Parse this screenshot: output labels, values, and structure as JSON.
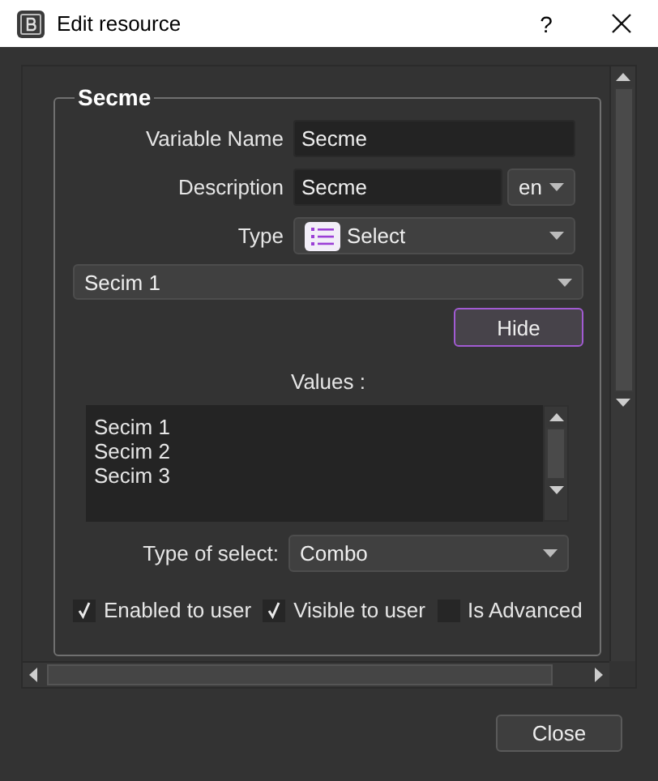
{
  "window": {
    "title": "Edit resource",
    "help": "?"
  },
  "group": {
    "title": "Secme"
  },
  "fields": [
    {
      "label": "Variable Name",
      "value": "Secme"
    },
    {
      "label": "Description",
      "value": "Secme",
      "language": "en"
    }
  ],
  "type": {
    "label": "Type",
    "value": "Select"
  },
  "selection": {
    "value": "Secim 1"
  },
  "hide_button": "Hide",
  "values": {
    "label": "Values :",
    "items": [
      "Secim 1",
      "Secim 2",
      "Secim 3"
    ]
  },
  "type_of_select": {
    "label": "Type of select:",
    "value": "Combo"
  },
  "options": [
    {
      "label": "Enabled to user",
      "checked": true
    },
    {
      "label": "Visible to user",
      "checked": true
    },
    {
      "label": "Is Advanced",
      "checked": false
    }
  ],
  "buttons": [
    "Close"
  ]
}
